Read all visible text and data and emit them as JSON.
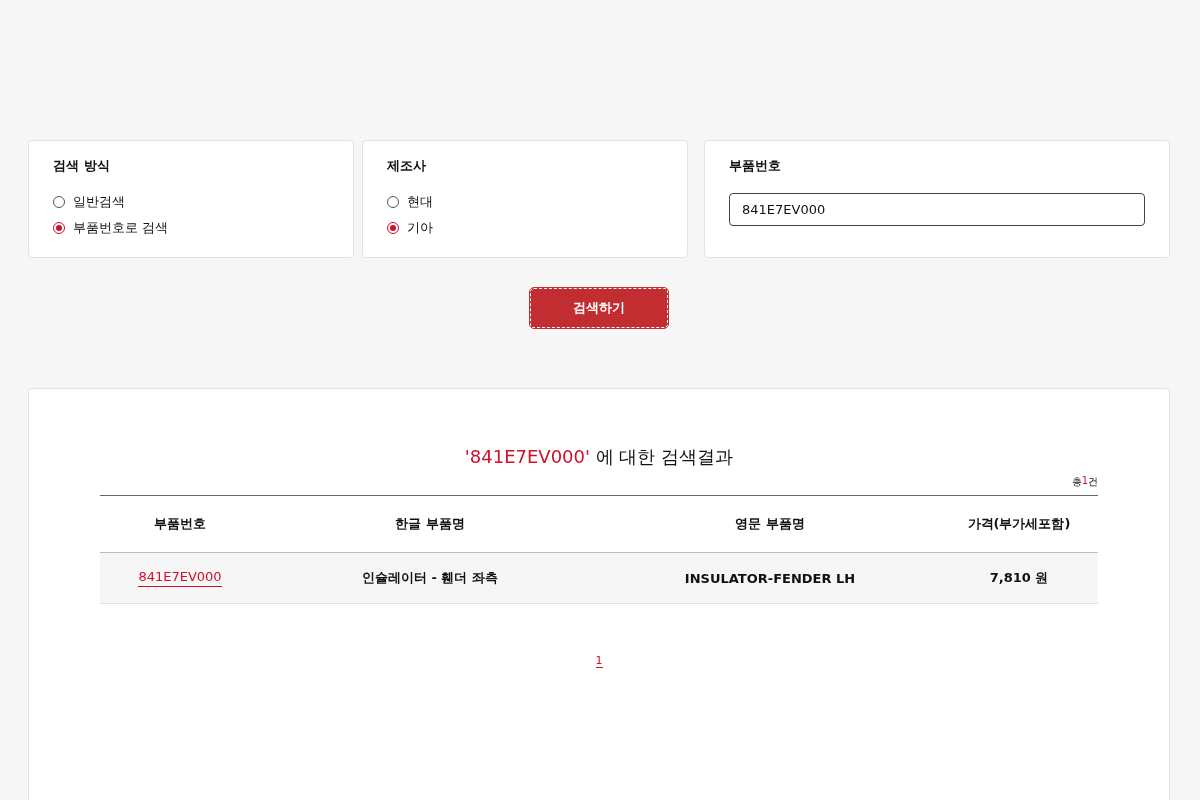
{
  "search_method": {
    "title": "검색 방식",
    "options": [
      {
        "label": "일반검색",
        "selected": false
      },
      {
        "label": "부품번호로 검색",
        "selected": true
      }
    ]
  },
  "manufacturer": {
    "title": "제조사",
    "options": [
      {
        "label": "현대",
        "selected": false
      },
      {
        "label": "기아",
        "selected": true
      }
    ]
  },
  "part_number": {
    "title": "부품번호",
    "value": "841E7EV000"
  },
  "search_button": "검색하기",
  "results": {
    "query": "'841E7EV000'",
    "title_suffix": "에 대한 검색결과",
    "count_prefix": "총",
    "count": "1",
    "count_suffix": "건",
    "columns": [
      "부품번호",
      "한글 부품명",
      "영문 부품명",
      "가격(부가세포함)"
    ],
    "rows": [
      {
        "part_no": "841E7EV000",
        "korean_name": "인슐레이터 - 휀더 좌측",
        "english_name": "INSULATOR-FENDER LH",
        "price": "7,810 원"
      }
    ],
    "pages": [
      {
        "label": "1",
        "selected": true
      }
    ]
  }
}
